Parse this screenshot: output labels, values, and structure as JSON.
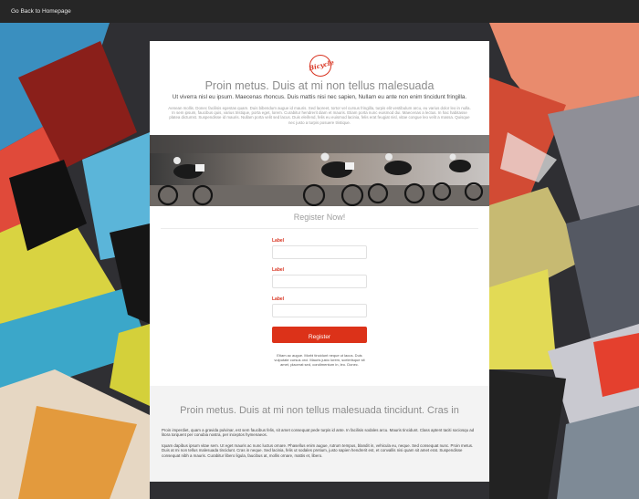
{
  "topbar": {
    "back_link": "Go Back to Homepage"
  },
  "card": {
    "logo_text": "Bicycle",
    "heading": "Proin metus. Duis at mi non tellus malesuada",
    "subheading": "Ut viverra nisl eu ipsum. Maecenas rhoncus. Duis mattis nisi nec sapien, Nullam eu ante non enim tincidunt fringilla.",
    "intro_text": "Aenean mollis. Donec facilisis egestas quam. Duis bibendum augue id mauris. Sed laoreet, tortor vel cursus fringilla, turpis elit vestibulum arcu, eu varius dolor leo in nulla. In sem ipsum, faucibus quis, varius tristique, porta eget, lorem. Curabitur hendrerit diam et mauris. Etiam porta nunc euismod dui. Maecenas a lectus. In hac habitasse platea dictumst. Suspendisse id mauris. Nullam porta velit sed lacus. Duis eleifend, felis eu euismod lacinia, felis erat feugiat nisl, vitae congue leo velit a massa. Quisque nec justo a turpis posuere tristique.",
    "banner_icon": "cyclists-photo"
  },
  "form": {
    "title": "Register Now!",
    "fields": [
      {
        "label": "Label",
        "value": ""
      },
      {
        "label": "Label",
        "value": ""
      },
      {
        "label": "Label",
        "value": ""
      }
    ],
    "submit_label": "Register",
    "fine_print": "Etiam ac augue. Morbi tincidunt neque ut lacus. Duis vulputate cursus orci. Mauris justo lorem, scelerisque sit amet, placerat sed, condimentum in, leo. Donec."
  },
  "footer": {
    "heading": "Proin metus. Duis at mi non tellus malesuada tincidunt. Cras in",
    "paragraph1": "Proin imperdiet, quam a gravida pulvinar, est sem faucibus felis, sit amet consequat pede turpis id ante. In facilisis sodales arcu. Mauris tincidunt. Class aptent taciti sociosqu ad litora torquent per conubia nostra, per inceptos hymenaeos.",
    "paragraph2": "Iquam dapibus ipsum vitae sem. Ut eget mauris ac nunc luctus ornare. Phasellus enim augue, rutrum tempus, blandit in, vehicula eu, neque. Sed consequat nunc. Proin metus. Duis at mi non tellus malesuada tincidunt. Cras in neque. Sed lacinia, felis ut sodales pretium, justo sapien hendrerit est, et convallis nisi quam sit amet erat. Suspendisse consequat nibh a mauris. Curabitur libero ligula, faucibus at, mollis ornare, mattis et, libero."
  },
  "colors": {
    "accent": "#dc3219",
    "topbar": "#262626",
    "card": "#ffffff",
    "footer_panel": "#f3f3f3"
  }
}
